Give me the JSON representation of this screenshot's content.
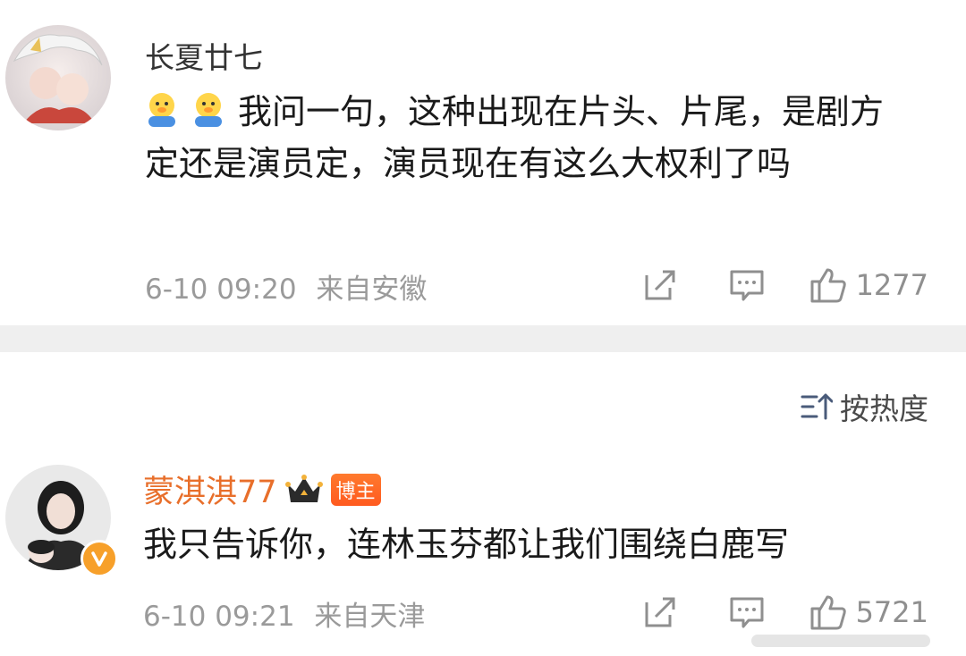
{
  "comment1": {
    "username": "长夏廿七",
    "text": "我问一句，这种出现在片头、片尾，是剧方定还是演员定，演员现在有这么大权利了吗",
    "timestamp": "6-10 09:20",
    "location": "来自安徽",
    "like_count": "1277",
    "emojis": [
      "duck-emoji",
      "duck-emoji"
    ]
  },
  "sort": {
    "label": "按热度",
    "icon": "sort-icon"
  },
  "comment2": {
    "username": "蒙淇淇77",
    "badge": "博主",
    "text": "我只告诉你，连林玉芬都让我们围绕白鹿写",
    "timestamp": "6-10 09:21",
    "location": "来自天津",
    "like_count": "5721"
  },
  "colors": {
    "username_highlight": "#e86f2b",
    "meta_gray": "#9a9a9a",
    "divider": "#efefef",
    "verified": "#f7a02a"
  }
}
